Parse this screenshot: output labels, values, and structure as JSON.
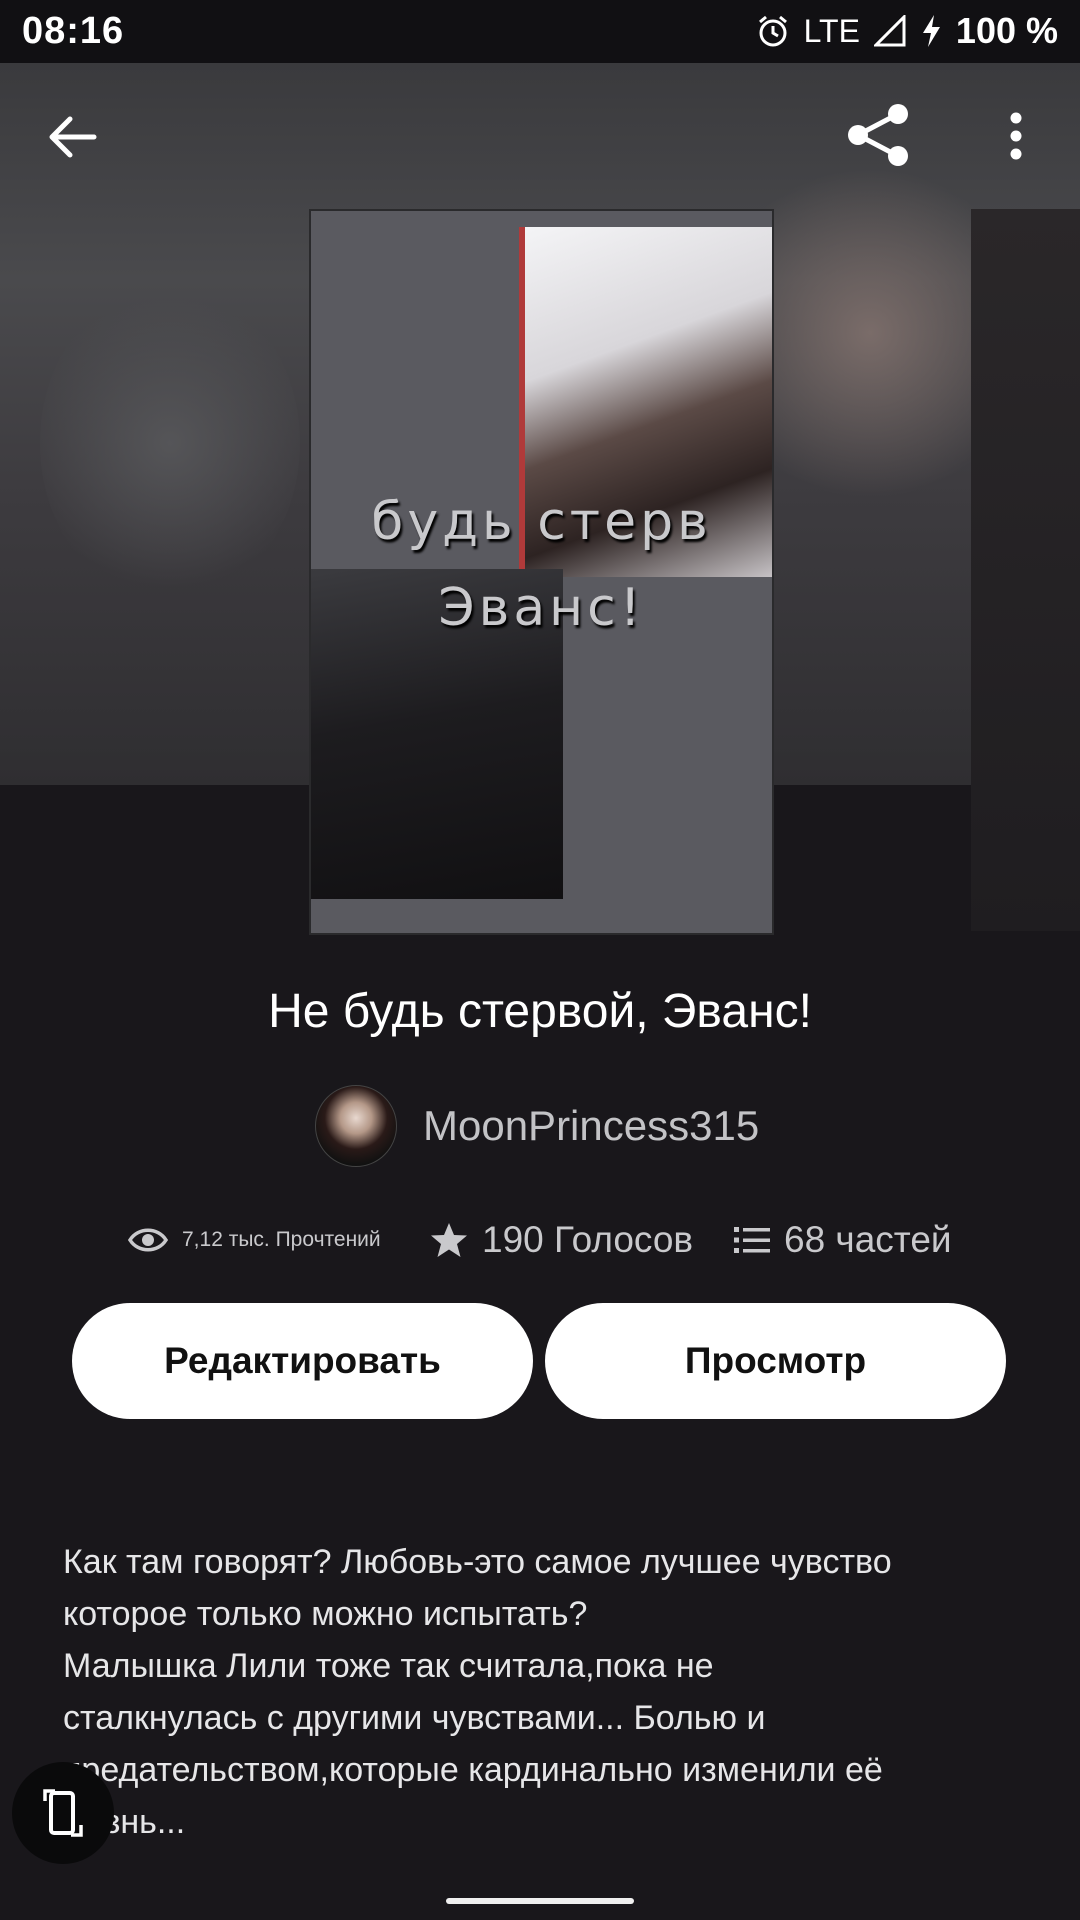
{
  "status_bar": {
    "time": "08:16",
    "network": "LTE",
    "battery": "100 %",
    "icons": [
      "alarm-icon",
      "signal-icon",
      "charging-icon"
    ]
  },
  "top_bar": {
    "icons": [
      "back-arrow-icon",
      "share-icon",
      "more-vertical-icon"
    ]
  },
  "cover": {
    "lines": [
      "будь стерв",
      "Эванс!"
    ]
  },
  "story": {
    "title": "Не будь стервой, Эванс!",
    "author": "MoonPrincess315"
  },
  "stats": {
    "reads": "7,12 тыс. Прочтений",
    "votes": "190 Голосов",
    "parts": "68 частей",
    "icons": [
      "eye-icon",
      "star-icon",
      "list-icon"
    ]
  },
  "actions": {
    "edit_label": "Редактировать",
    "view_label": "Просмотр"
  },
  "description": {
    "lines": [
      "Как там говорят? Любовь-это самое лучшее чувство",
      "которое только можно испытать?",
      "Малышка Лили тоже так считала,пока не",
      "сталкнулась с другими чувствами... Болью и",
      "предательством,которые кардинально изменили её",
      "жизнь..."
    ]
  },
  "colors": {
    "background": "#19171b",
    "button": "#ffffff",
    "secondary_text": "#c3c3c6"
  }
}
